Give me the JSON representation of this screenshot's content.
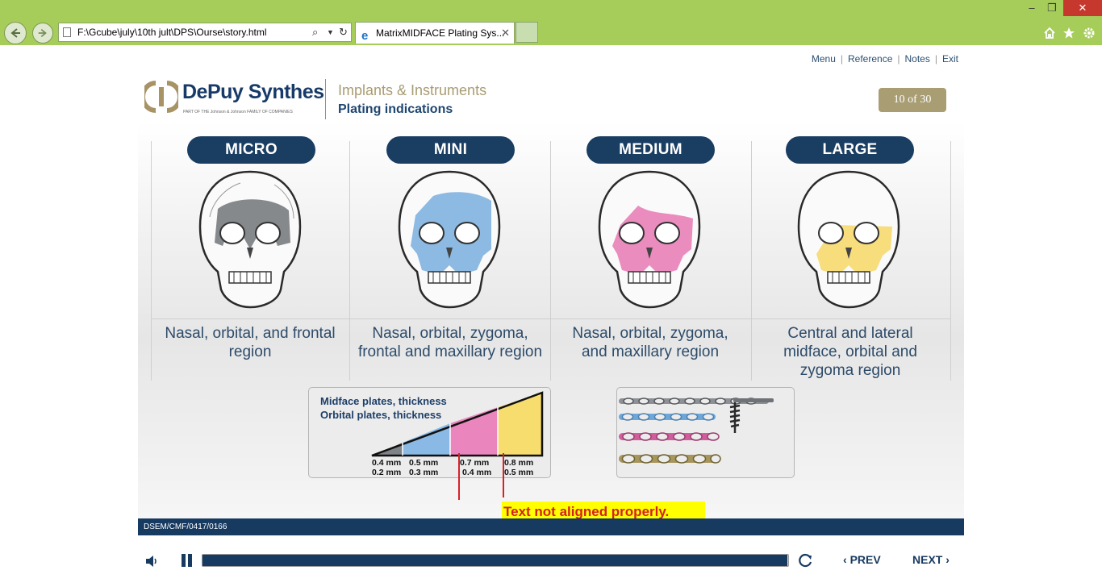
{
  "browser": {
    "address": "F:\\Gcube\\july\\10th jult\\DPS\\Ourse\\story.html",
    "tab_title": "MatrixMIDFACE Plating Sys...",
    "colors": {
      "frame": "#a6cc5a",
      "close": "#c6372d"
    }
  },
  "top_links": [
    "Menu",
    "Reference",
    "Notes",
    "Exit"
  ],
  "header": {
    "brand": "DePuy Synthes",
    "brand_tagline": "PART OF THE Johnson & Johnson FAMILY OF COMPANIES",
    "section": "Implants & Instruments",
    "subtitle": "Plating indications",
    "counter": "10 of 30"
  },
  "categories": [
    {
      "label": "MICRO",
      "description": "Nasal, orbital, and frontal region",
      "color": "#707478"
    },
    {
      "label": "MINI",
      "description": "Nasal, orbital, zygoma, frontal and maxillary region",
      "color": "#7fb3e0"
    },
    {
      "label": "MEDIUM",
      "description": "Nasal, orbital, zygoma, and maxillary region",
      "color": "#e980b8"
    },
    {
      "label": "LARGE",
      "description": "Central and lateral midface, orbital and zygoma region",
      "color": "#f7db74"
    }
  ],
  "thickness_diagram": {
    "line1": "Midface plates, thickness",
    "line2": "Orbital plates, thickness",
    "ticks": [
      {
        "midface": "0.4 mm",
        "orbital": "0.2 mm"
      },
      {
        "midface": "0.5 mm",
        "orbital": "0.3 mm"
      },
      {
        "midface": "0.7 mm",
        "orbital": "0.4 mm"
      },
      {
        "midface": "0.8 mm",
        "orbital": "0.5 mm"
      }
    ]
  },
  "annotation": "Text not aligned properly.",
  "footer_code": "DSEM/CMF/0417/0166",
  "player": {
    "progress": 0.998,
    "prev": "PREV",
    "next": "NEXT"
  }
}
